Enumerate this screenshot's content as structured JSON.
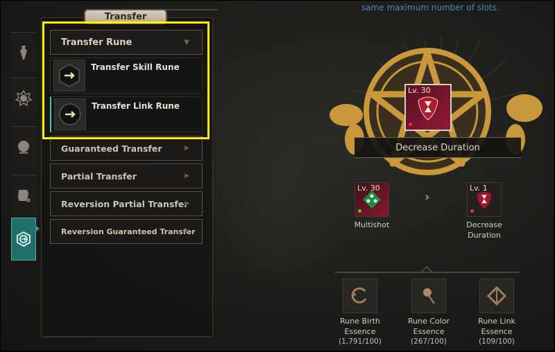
{
  "panel": {
    "title": "Transfer",
    "dropdown": {
      "label": "Transfer Rune",
      "arrow": "▼"
    },
    "sub_items": [
      {
        "label": "Transfer Skill Rune",
        "icon": "hexagon-arrow-icon",
        "selected": false
      },
      {
        "label": "Transfer Link Rune",
        "icon": "circle-arrow-icon",
        "selected": true
      }
    ],
    "menu_items": [
      {
        "label": "Guaranteed Transfer",
        "arrow": "▶"
      },
      {
        "label": "Partial Transfer",
        "arrow": "▶"
      },
      {
        "label": "Reversion Partial Transfer",
        "arrow": "▶"
      },
      {
        "label": "Reversion Guaranteed Transfer",
        "arrow": "▶"
      }
    ]
  },
  "rail_tabs": [
    {
      "icon": "potion-icon",
      "active": false
    },
    {
      "icon": "star-gear-icon",
      "active": false
    },
    {
      "icon": "orb-icon",
      "active": false
    },
    {
      "icon": "scroll-icon",
      "active": false
    },
    {
      "icon": "transfer-icon",
      "active": true
    }
  ],
  "notice": "same maximum number of slots.",
  "target": {
    "level": "Lv. 30",
    "name": "Decrease Duration",
    "color": "#8e1a34"
  },
  "transfer": {
    "source": {
      "level": "Lv. 30",
      "name": "Multishot",
      "dot_color": "#37d24a"
    },
    "arrow": "›",
    "result": {
      "level": "Lv. 1",
      "name_line1": "Decrease",
      "name_line2": "Duration",
      "dot_color": "#e0303c"
    }
  },
  "essences": [
    {
      "name_line1": "Rune Birth",
      "name_line2": "Essence",
      "count": "(1,791/100)",
      "icon": "thorn-ring-icon"
    },
    {
      "name_line1": "Rune Color",
      "name_line2": "Essence",
      "count": "(267/100)",
      "icon": "flower-icon"
    },
    {
      "name_line1": "Rune Link",
      "name_line2": "Essence",
      "count": "(109/100)",
      "icon": "diamond-link-icon"
    }
  ],
  "colors": {
    "accent_teal": "#1f6f6a",
    "highlight_yellow": "#fff200",
    "notice_blue": "#4b86b8",
    "gold": "#c9983a"
  }
}
